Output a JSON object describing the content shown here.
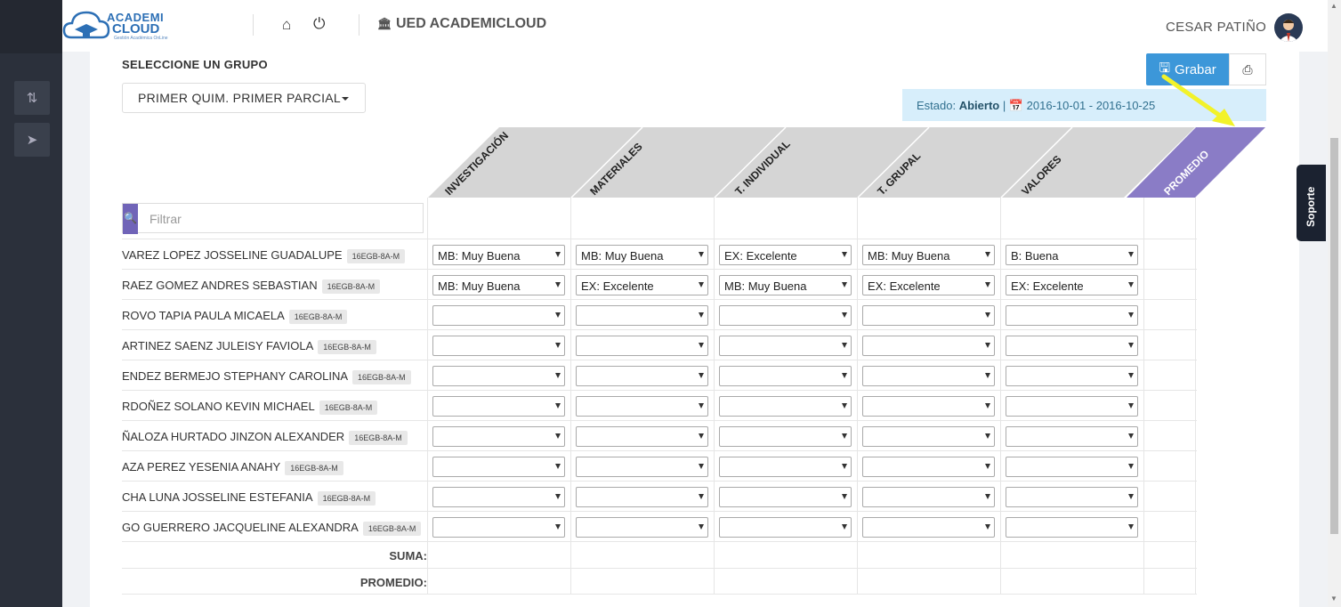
{
  "app": {
    "logo_line1": "ACADEMI",
    "logo_line2": "CLOUD",
    "logo_tagline": "Gestión Académica OnLine",
    "brand": "UED ACADEMICLOUD",
    "user_name": "CESAR PATIÑO"
  },
  "group": {
    "title": "SELECCIONE UN GRUPO",
    "selected": "PRIMER QUIM. PRIMER PARCIAL"
  },
  "actions": {
    "save_label": "Grabar"
  },
  "status": {
    "label": "Estado:",
    "value": "Abierto",
    "separator": "|",
    "date_range": "2016-10-01 - 2016-10-25"
  },
  "columns": [
    "INVESTIGACIÓN",
    "MATERIALES",
    "T. INDIVIDUAL",
    "T. GRUPAL",
    "VALORES",
    "PROMEDIO"
  ],
  "filter": {
    "placeholder": "Filtrar"
  },
  "students": [
    {
      "name": "VAREZ LOPEZ JOSSELINE GUADALUPE",
      "tag": "16EGB-8A-M",
      "grades": [
        "MB: Muy Buena",
        "MB: Muy Buena",
        "EX: Excelente",
        "MB: Muy Buena",
        "B: Buena"
      ]
    },
    {
      "name": "RAEZ GOMEZ ANDRES SEBASTIAN",
      "tag": "16EGB-8A-M",
      "grades": [
        "MB: Muy Buena",
        "EX: Excelente",
        "MB: Muy Buena",
        "EX: Excelente",
        "EX: Excelente"
      ]
    },
    {
      "name": "ROVO TAPIA PAULA MICAELA",
      "tag": "16EGB-8A-M",
      "grades": [
        "",
        "",
        "",
        "",
        ""
      ]
    },
    {
      "name": "ARTINEZ SAENZ JULEISY FAVIOLA",
      "tag": "16EGB-8A-M",
      "grades": [
        "",
        "",
        "",
        "",
        ""
      ]
    },
    {
      "name": "ENDEZ BERMEJO STEPHANY CAROLINA",
      "tag": "16EGB-8A-M",
      "grades": [
        "",
        "",
        "",
        "",
        ""
      ]
    },
    {
      "name": "RDOÑEZ SOLANO KEVIN MICHAEL",
      "tag": "16EGB-8A-M",
      "grades": [
        "",
        "",
        "",
        "",
        ""
      ]
    },
    {
      "name": "ÑALOZA HURTADO JINZON ALEXANDER",
      "tag": "16EGB-8A-M",
      "grades": [
        "",
        "",
        "",
        "",
        ""
      ]
    },
    {
      "name": "AZA PEREZ YESENIA ANAHY",
      "tag": "16EGB-8A-M",
      "grades": [
        "",
        "",
        "",
        "",
        ""
      ]
    },
    {
      "name": "CHA LUNA JOSSELINE ESTEFANIA",
      "tag": "16EGB-8A-M",
      "grades": [
        "",
        "",
        "",
        "",
        ""
      ]
    },
    {
      "name": "GO GUERRERO JACQUELINE ALEXANDRA",
      "tag": "16EGB-8A-M",
      "grades": [
        "",
        "",
        "",
        "",
        ""
      ]
    }
  ],
  "footer": {
    "sum_label": "SUMA:",
    "avg_label": "PROMEDIO:"
  },
  "support": {
    "label": "Soporte"
  },
  "colors": {
    "accent": "#3c97d9",
    "promedio_header": "#8a7cc6",
    "header_band": "#d5d5d5",
    "sidebar": "#2b303b",
    "arrow": "#f2f22a"
  },
  "icons": [
    "home-icon",
    "power-icon",
    "bank-icon",
    "save-icon",
    "print-icon",
    "calendar-icon",
    "search-icon",
    "sort-icon",
    "send-icon"
  ]
}
